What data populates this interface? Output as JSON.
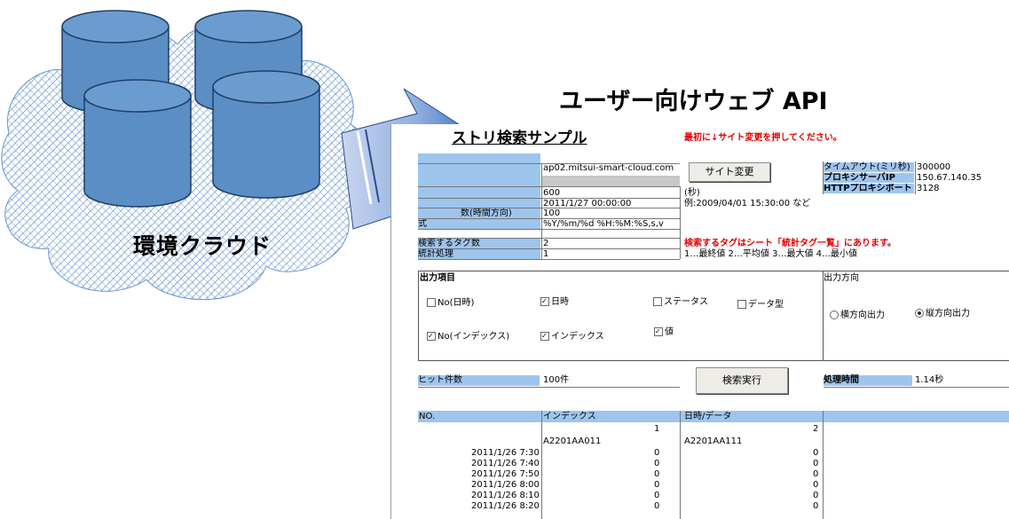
{
  "cloud_label": "環境クラウド",
  "api_title": "ユーザー向けウェブ API",
  "sheet": {
    "title": "ストリ検索サンプル",
    "notice": "最初に↓サイト変更を押してください。",
    "site_button": "サイト変更",
    "url": "ap02.mitsui-smart-cloud.com",
    "f_600": "600",
    "seconds": "(秒)",
    "date": "2011/1/27 00:00:00",
    "date_example": "例:2009/04/01 15:30:00 など",
    "count_label": "数(時間方向)",
    "count_value": "100",
    "format_label": "式",
    "format_value": "%Y/%m/%d %H:%M:%S,s,v",
    "tag_count_label": "検索するタグ数",
    "tag_count_value": "2",
    "tag_notice": "検索するタグはシート「統計タグ一覧」にあります。",
    "stat_label": "統計処理",
    "stat_value": "1",
    "stat_help": "1…最終値 2…平均値 3…最大値 4…最小値",
    "timeout_label": "タイムアウト(ミリ秒)",
    "timeout_value": "300000",
    "proxy_ip_label": "プロキシサーバIP",
    "proxy_ip_value": "150.67.140.35",
    "proxy_port_label": "HTTPプロキシポート",
    "proxy_port_value": "3128",
    "output_items_label": "出力項目",
    "output_dir_label": "出力方向",
    "opt_no_datetime": "No(日時)",
    "opt_datetime": "日時",
    "opt_status": "ステータス",
    "opt_datatype": "データ型",
    "opt_no_index": "No(インデックス)",
    "opt_index": "インデックス",
    "opt_value": "値",
    "dir_horizontal": "横方向出力",
    "dir_vertical": "縦方向出力",
    "hits_label": "ヒット件数",
    "hits_value": "100件",
    "search_button": "検索実行",
    "time_label": "処理時間",
    "time_value": "1.14秒",
    "col_no": "NO.",
    "col_index": "インデックス",
    "col_datetime": "日時/データ",
    "idx1": "1",
    "idx2": "2",
    "tag1": "A2201AA011",
    "tag2": "A2201AA111",
    "rows": [
      {
        "t": "2011/1/26 7:30",
        "a": "0",
        "b": "0"
      },
      {
        "t": "2011/1/26 7:40",
        "a": "0",
        "b": "0"
      },
      {
        "t": "2011/1/26 7:50",
        "a": "0",
        "b": "0"
      },
      {
        "t": "2011/1/26 8:00",
        "a": "0",
        "b": "0"
      },
      {
        "t": "2011/1/26 8:10",
        "a": "0",
        "b": "0"
      },
      {
        "t": "2011/1/26 8:20",
        "a": "0",
        "b": "0"
      }
    ]
  },
  "colors": {
    "cylinder": "#5b8ec4",
    "cloud_hatch": "#4a7fc4",
    "arrow": "#3e6dbd",
    "header_fill": "#9ec5ee"
  }
}
